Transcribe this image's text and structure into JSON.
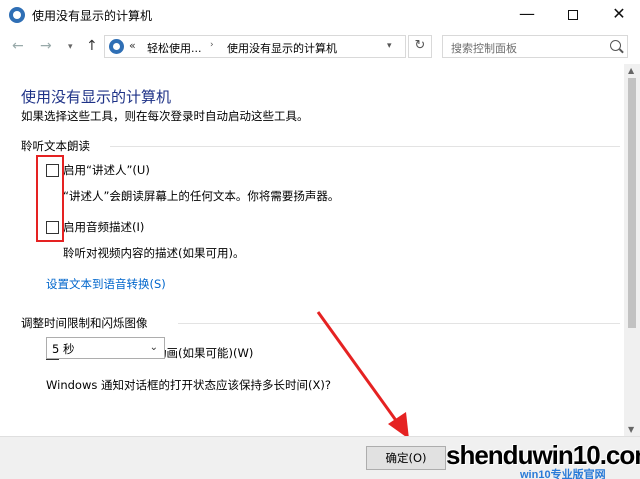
{
  "window": {
    "title": "使用没有显示的计算机",
    "minimize": "—",
    "close": "✕"
  },
  "nav": {
    "back": "←",
    "forward": "→",
    "dropdown": "▾",
    "up": "↑",
    "address_chevron": "«",
    "crumb1": "轻松使用...",
    "crumb_sep": "›",
    "crumb2": "使用没有显示的计算机",
    "address_dropdown": "▾",
    "refresh": "↻",
    "search_placeholder": "搜索控制面板"
  },
  "page": {
    "title": "使用没有显示的计算机",
    "subtitle": "如果选择这些工具，则在每次登录时自动启动这些工具。"
  },
  "section_narration": {
    "label": "聆听文本朗读",
    "option1_label": "启用“讲述人”(U)",
    "option1_desc": "“讲述人”会朗读屏幕上的任何文本。你将需要扬声器。",
    "option2_label": "启用音频描述(I)",
    "option2_desc": "聆听对视频内容的描述(如果可用)。",
    "link": "设置文本到语音转换(S)"
  },
  "section_timing": {
    "label": "调整时间限制和闪烁图像",
    "option1_label": "关闭所有不必要的动画(如果可能)(W)",
    "notification_question": "Windows 通知对话框的打开状态应该保持多长时间(X)?",
    "select_value": "5 秒",
    "select_arrow": "⌄"
  },
  "footer": {
    "ok_label": "确定(O)"
  },
  "watermark": {
    "main": "shenduwin10.com",
    "sub": "win10专业版官网"
  },
  "scrollbar": {
    "up": "▲",
    "down": "▼"
  },
  "colors": {
    "title_blue": "#1e3287",
    "link_blue": "#0066cc",
    "annotation_red": "#e52222"
  }
}
